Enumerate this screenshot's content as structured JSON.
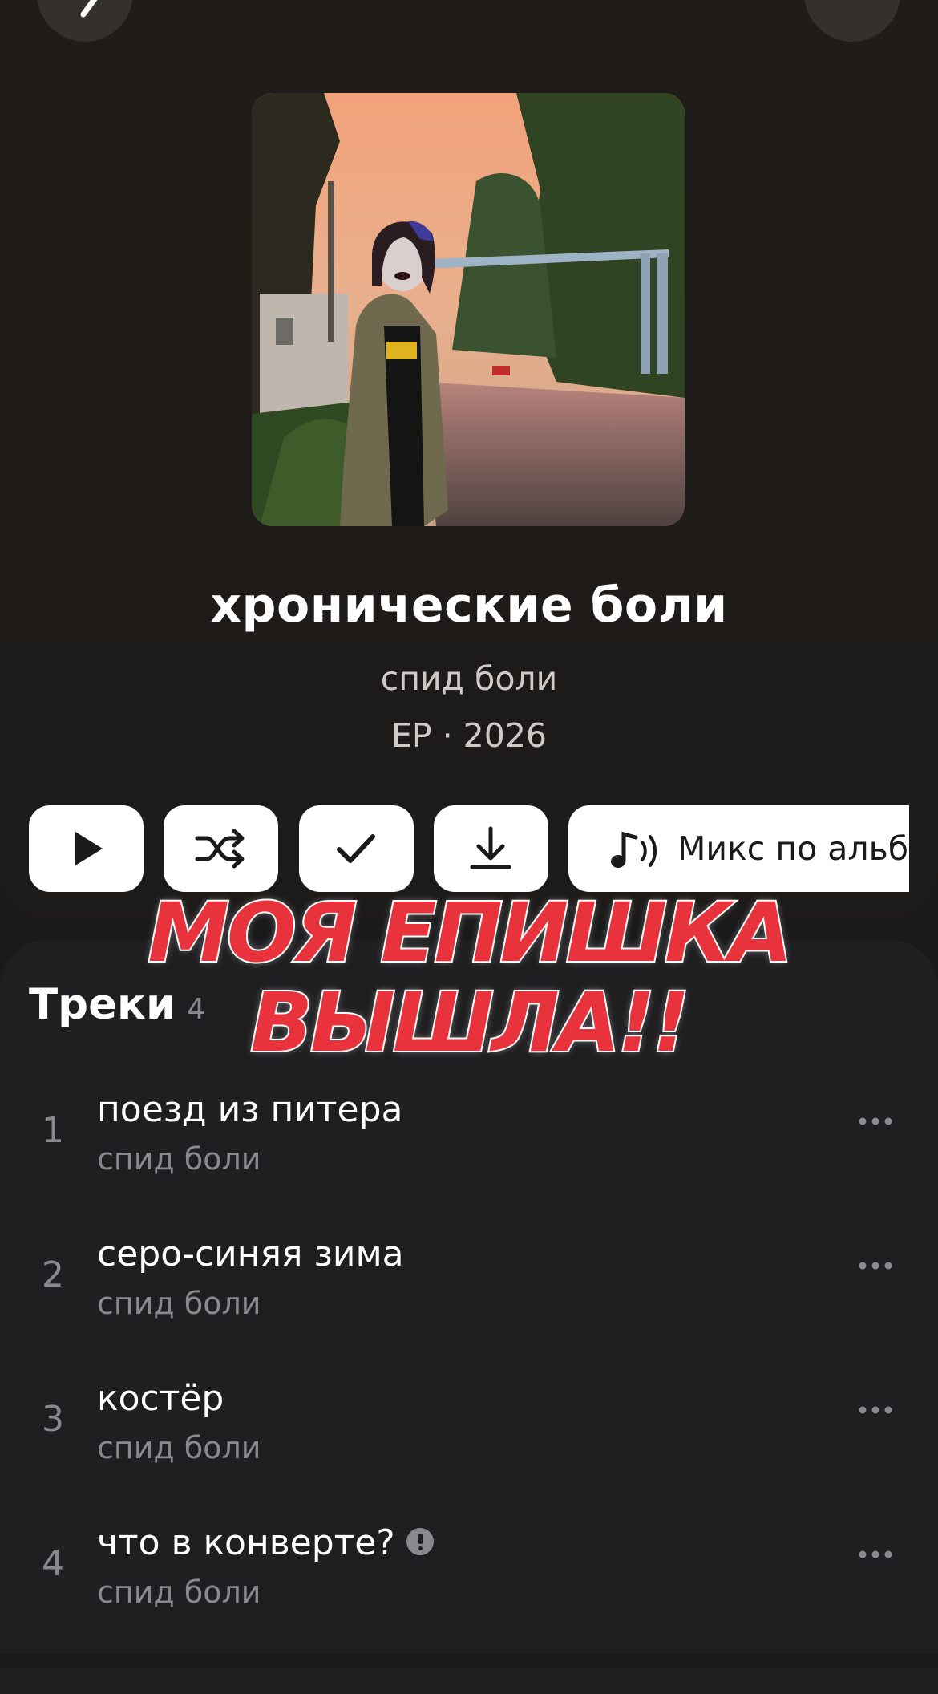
{
  "album": {
    "title": "хронические боли",
    "artist": "спид боли",
    "meta": "EP · 2026"
  },
  "actions": {
    "play_icon": "play-icon",
    "shuffle_icon": "shuffle-icon",
    "like_icon": "check-icon",
    "download_icon": "download-icon",
    "mix_label": "Микс по альбому"
  },
  "tracks": {
    "title": "Треки",
    "count": "4",
    "items": [
      {
        "num": "1",
        "title": "поезд из питера",
        "artist": "спид боли",
        "explicit": false
      },
      {
        "num": "2",
        "title": "серо-синяя зима",
        "artist": "спид боли",
        "explicit": false
      },
      {
        "num": "3",
        "title": "костёр",
        "artist": "спид боли",
        "explicit": false
      },
      {
        "num": "4",
        "title": "что в конверте?",
        "artist": "спид боли",
        "explicit": true
      }
    ]
  },
  "overlay": {
    "line1": "МОЯ ЕПИШКА",
    "line2": "ВЫШЛА!!"
  },
  "colors": {
    "background": "#1a1a1c",
    "overlay_text": "#e8333c",
    "button_bg": "#ffffff"
  }
}
